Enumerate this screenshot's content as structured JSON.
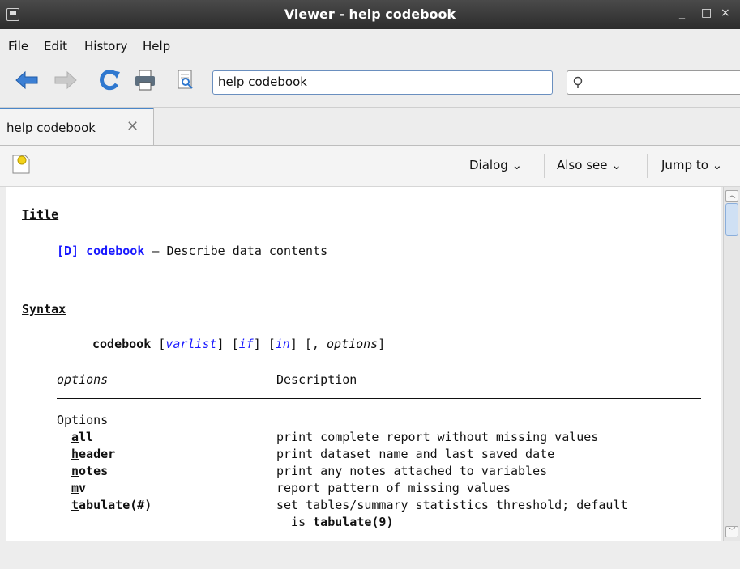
{
  "window": {
    "title": "Viewer - help codebook",
    "minimize": "_",
    "maximize": "□",
    "close": "×"
  },
  "menu": [
    "File",
    "Edit",
    "History",
    "Help"
  ],
  "toolbar": {
    "address": "help codebook",
    "search_icon": "search-icon"
  },
  "tab": {
    "label": "help codebook"
  },
  "helpbar": {
    "dialog": "Dialog",
    "also_see": "Also see",
    "jump_to": "Jump to"
  },
  "doc": {
    "title_heading": "Title",
    "title_ref": "[D] codebook",
    "title_desc": " — Describe data contents",
    "syntax_heading": "Syntax",
    "syntax": {
      "cmd": "codebook",
      "sp1": " [",
      "varlist": "varlist",
      "c1": "] [",
      "if": "if",
      "c2": "] [",
      "in": "in",
      "c3": "] [, ",
      "options": "options",
      "c4": "]"
    },
    "table_head": {
      "col1": "options",
      "col2": "Description"
    },
    "group": "Options",
    "rows": [
      {
        "u": "a",
        "rest": "ll",
        "desc": "print complete report without missing values"
      },
      {
        "u": "h",
        "rest": "eader",
        "desc": "print dataset name and last saved date"
      },
      {
        "u": "n",
        "rest": "otes",
        "desc": "print any notes attached to variables"
      },
      {
        "u": "m",
        "rest": "v",
        "desc": "report pattern of missing values"
      },
      {
        "u": "t",
        "rest": "abulate(#)",
        "desc": "set tables/summary statistics threshold; default"
      }
    ],
    "cont_pre": "  is ",
    "cont_bold": "tabulate(9)"
  }
}
